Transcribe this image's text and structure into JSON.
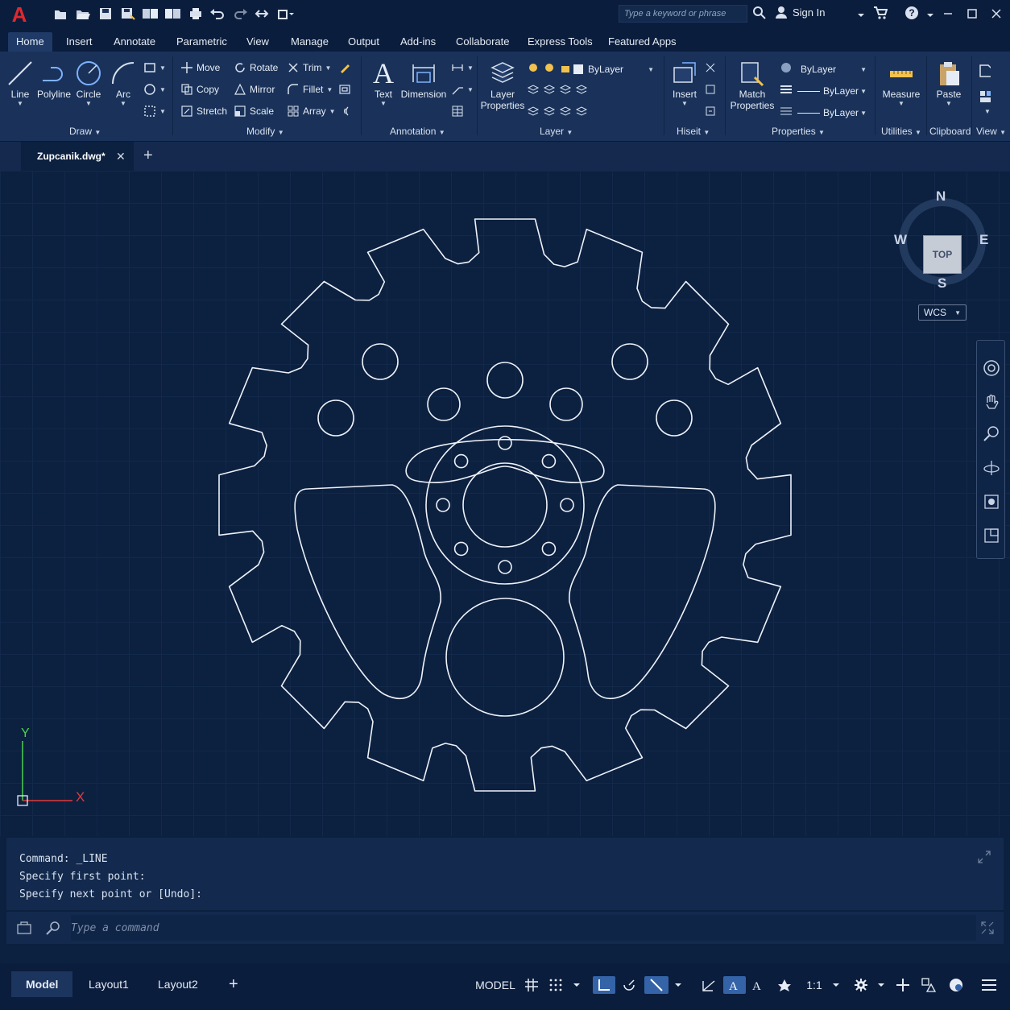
{
  "app": {
    "logo": "A"
  },
  "titlebar": {
    "search_placeholder": "Type a keyword or phrase",
    "sign_in": "Sign In"
  },
  "ribbon_tabs": [
    "Home",
    "Insert",
    "Annotate",
    "Parametric",
    "View",
    "Manage",
    "Output",
    "Add-ins",
    "Collaborate",
    "Express Tools",
    "Featured Apps"
  ],
  "ribbon": {
    "draw": {
      "title": "Draw",
      "line": "Line",
      "polyline": "Polyline",
      "circle": "Circle",
      "arc": "Arc"
    },
    "modify": {
      "title": "Modify",
      "move": "Move",
      "rotate": "Rotate",
      "trim": "Trim",
      "copy": "Copy",
      "mirror": "Mirror",
      "fillet": "Fillet",
      "stretch": "Stretch",
      "scale": "Scale",
      "array": "Array"
    },
    "annotation": {
      "title": "Annotation",
      "text": "Text",
      "dimension": "Dimension"
    },
    "layer": {
      "title": "Layer",
      "layer_properties_1": "Layer",
      "layer_properties_2": "Properties",
      "current_layer": "ByLayer"
    },
    "block": {
      "title": "Hiseit",
      "insert": "Insert"
    },
    "properties": {
      "title": "Properties",
      "match_1": "Match",
      "match_2": "Properties",
      "color": "ByLayer",
      "lineweight": "ByLayer",
      "linetype": "ByLayer"
    },
    "utilities": {
      "title": "Utilities",
      "measure": "Measure"
    },
    "clipboard": {
      "title": "Clipboard",
      "paste": "Paste"
    },
    "view": {
      "title": "View"
    }
  },
  "file_tab": {
    "name": "Zupcanik.dwg*"
  },
  "viewcube": {
    "n": "N",
    "s": "S",
    "e": "E",
    "w": "W",
    "face": "TOP",
    "wcs": "WCS"
  },
  "ucs": {
    "x": "X",
    "y": "Y"
  },
  "command": {
    "history": [
      "Command: _LINE",
      "Specify first point:",
      "Specify next point or [Undo]:"
    ],
    "placeholder": "Type a command"
  },
  "layouts": [
    "Model",
    "Layout1",
    "Layout2"
  ],
  "status": {
    "model": "MODEL",
    "scale": "1:1"
  },
  "colors": {
    "background": "#0c2040",
    "ribbon": "#1a325a",
    "accent": "#3463a8",
    "logo_red": "#e0282f"
  }
}
